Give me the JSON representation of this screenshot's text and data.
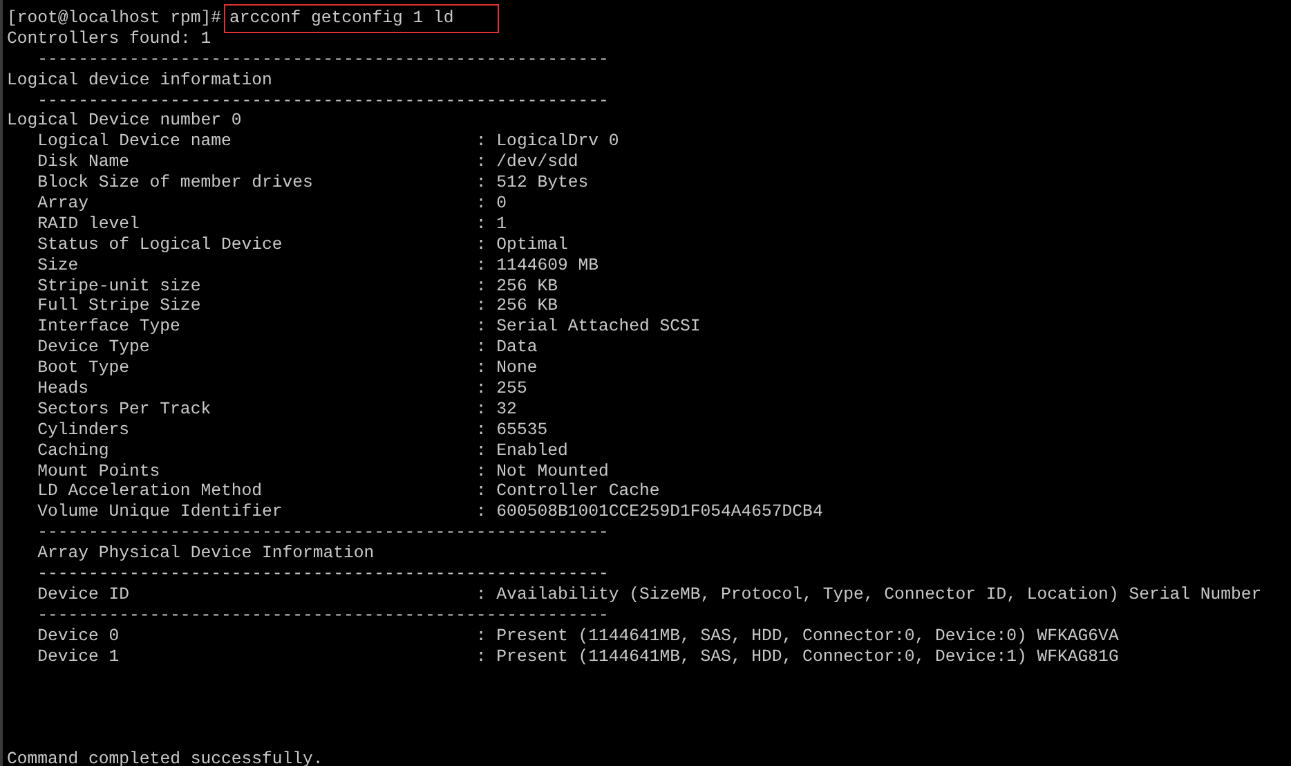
{
  "terminal": {
    "lines": [
      {
        "kind": "prompt",
        "prompt": "[root@localhost rpm]#",
        "command": "arcconf getconfig 1 ld",
        "highlighted": true
      },
      {
        "kind": "text",
        "text": "Controllers found: 1"
      },
      {
        "kind": "rule",
        "text": "--------------------------------------------------------"
      },
      {
        "kind": "text",
        "text": "Logical device information"
      },
      {
        "kind": "rule",
        "text": "--------------------------------------------------------"
      },
      {
        "kind": "text",
        "text": "Logical Device number 0"
      },
      {
        "kind": "field",
        "label": "Logical Device name",
        "value": ": LogicalDrv 0"
      },
      {
        "kind": "field",
        "label": "Disk Name",
        "value": ": /dev/sdd"
      },
      {
        "kind": "field",
        "label": "Block Size of member drives",
        "value": ": 512 Bytes"
      },
      {
        "kind": "field",
        "label": "Array",
        "value": ": 0"
      },
      {
        "kind": "field",
        "label": "RAID level",
        "value": ": 1"
      },
      {
        "kind": "field",
        "label": "Status of Logical Device",
        "value": ": Optimal"
      },
      {
        "kind": "field",
        "label": "Size",
        "value": ": 1144609 MB"
      },
      {
        "kind": "field",
        "label": "Stripe-unit size",
        "value": ": 256 KB"
      },
      {
        "kind": "field",
        "label": "Full Stripe Size",
        "value": ": 256 KB"
      },
      {
        "kind": "field",
        "label": "Interface Type",
        "value": ": Serial Attached SCSI"
      },
      {
        "kind": "field",
        "label": "Device Type",
        "value": ": Data"
      },
      {
        "kind": "field",
        "label": "Boot Type",
        "value": ": None"
      },
      {
        "kind": "field",
        "label": "Heads",
        "value": ": 255"
      },
      {
        "kind": "field",
        "label": "Sectors Per Track",
        "value": ": 32"
      },
      {
        "kind": "field",
        "label": "Cylinders",
        "value": ": 65535"
      },
      {
        "kind": "field",
        "label": "Caching",
        "value": ": Enabled"
      },
      {
        "kind": "field",
        "label": "Mount Points",
        "value": ": Not Mounted"
      },
      {
        "kind": "field",
        "label": "LD Acceleration Method",
        "value": ": Controller Cache"
      },
      {
        "kind": "field",
        "label": "Volume Unique Identifier",
        "value": ": 600508B1001CCE259D1F054A4657DCB4"
      },
      {
        "kind": "rule",
        "text": "--------------------------------------------------------"
      },
      {
        "kind": "subheading",
        "text": "Array Physical Device Information"
      },
      {
        "kind": "rule",
        "text": "--------------------------------------------------------"
      },
      {
        "kind": "field",
        "label": "Device ID",
        "value": ": Availability (SizeMB, Protocol, Type, Connector ID, Location) Serial Number"
      },
      {
        "kind": "rule",
        "text": "--------------------------------------------------------"
      },
      {
        "kind": "field",
        "label": "Device 0",
        "value": ": Present (1144641MB, SAS, HDD, Connector:0, Device:0) WFKAG6VA"
      },
      {
        "kind": "field",
        "label": "Device 1",
        "value": ": Present (1144641MB, SAS, HDD, Connector:0, Device:1) WFKAG81G"
      },
      {
        "kind": "blank"
      },
      {
        "kind": "blank"
      },
      {
        "kind": "blank"
      },
      {
        "kind": "blank"
      },
      {
        "kind": "text",
        "text": "Command completed successfully."
      }
    ]
  }
}
